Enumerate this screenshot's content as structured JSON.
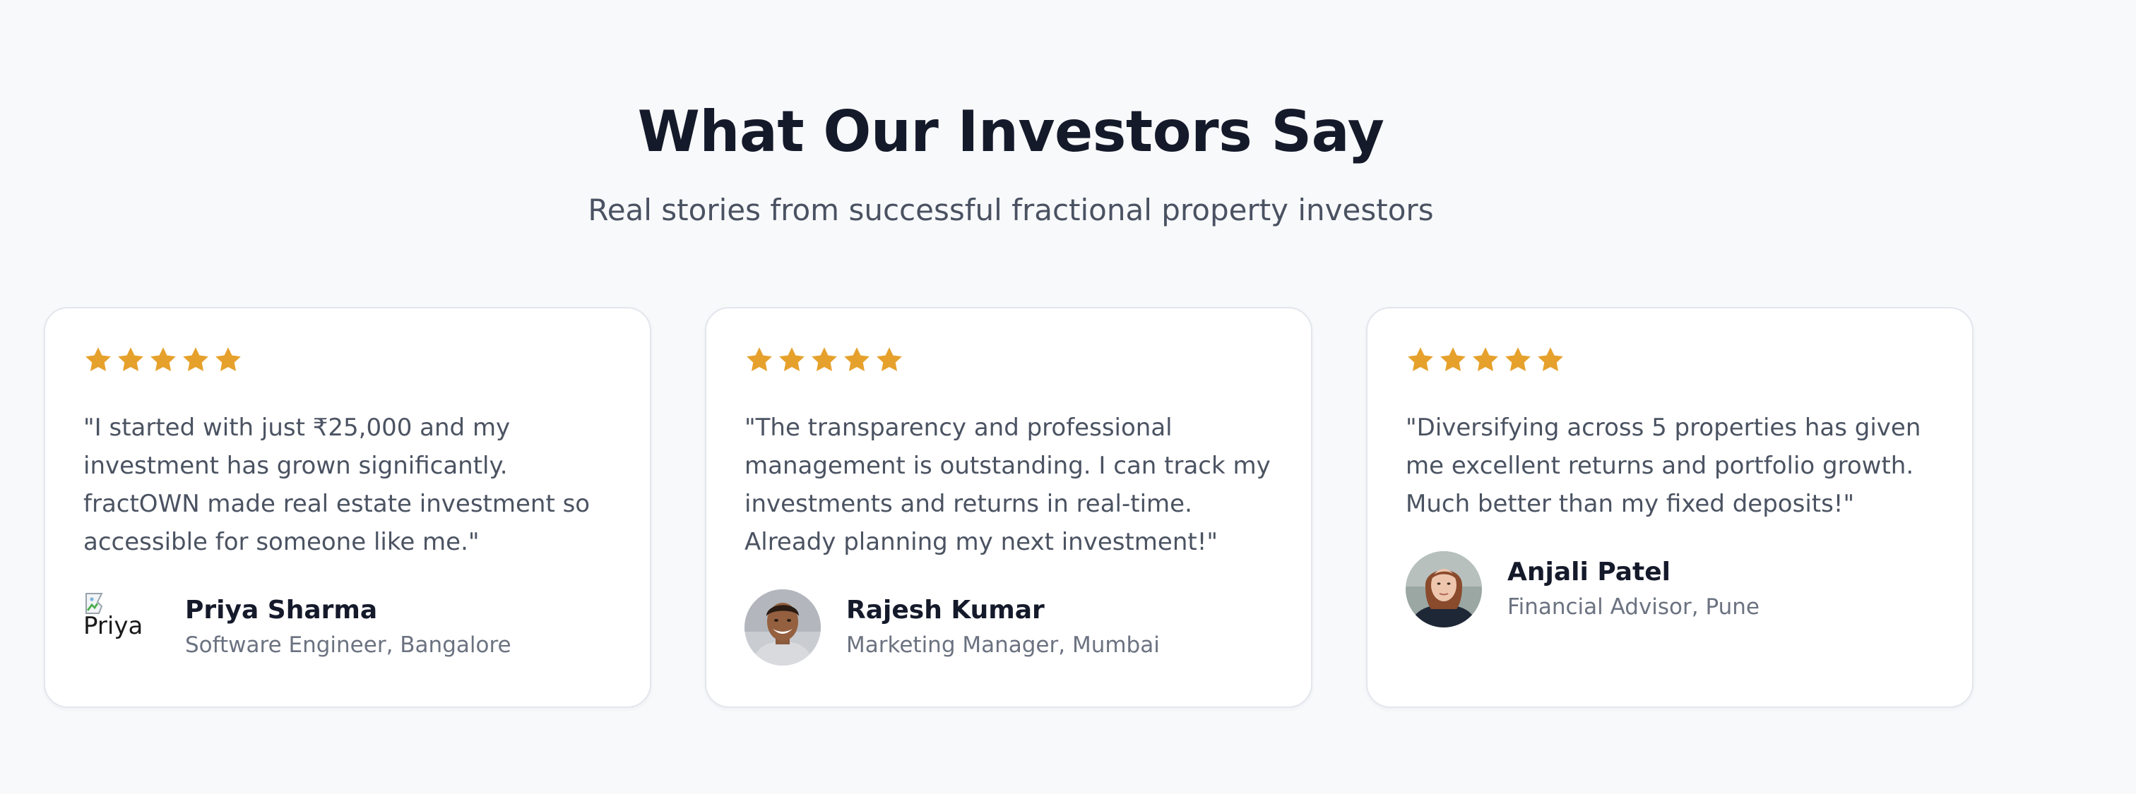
{
  "section": {
    "title": "What Our Investors Say",
    "subtitle": "Real stories from successful fractional property investors"
  },
  "colors": {
    "star": "#e6a12c",
    "card_bg": "#ffffff",
    "page_bg": "#f8f9fb"
  },
  "testimonials": [
    {
      "rating": 5,
      "quote": "\"I started with just ₹25,000 and my investment has grown significantly. fractOWN made real estate investment so accessible for someone like me.\"",
      "name": "Priya Sharma",
      "role": "Software Engineer, Bangalore",
      "avatar_alt": "Priya",
      "avatar_state": "broken-image"
    },
    {
      "rating": 5,
      "quote": "\"The transparency and professional management is outstanding. I can track my investments and returns in real-time. Already planning my next investment!\"",
      "name": "Rajesh Kumar",
      "role": "Marketing Manager, Mumbai",
      "avatar_state": "photo"
    },
    {
      "rating": 5,
      "quote": "\"Diversifying across 5 properties has given me excellent returns and portfolio growth. Much better than my fixed deposits!\"",
      "name": "Anjali Patel",
      "role": "Financial Advisor, Pune",
      "avatar_state": "photo"
    }
  ]
}
